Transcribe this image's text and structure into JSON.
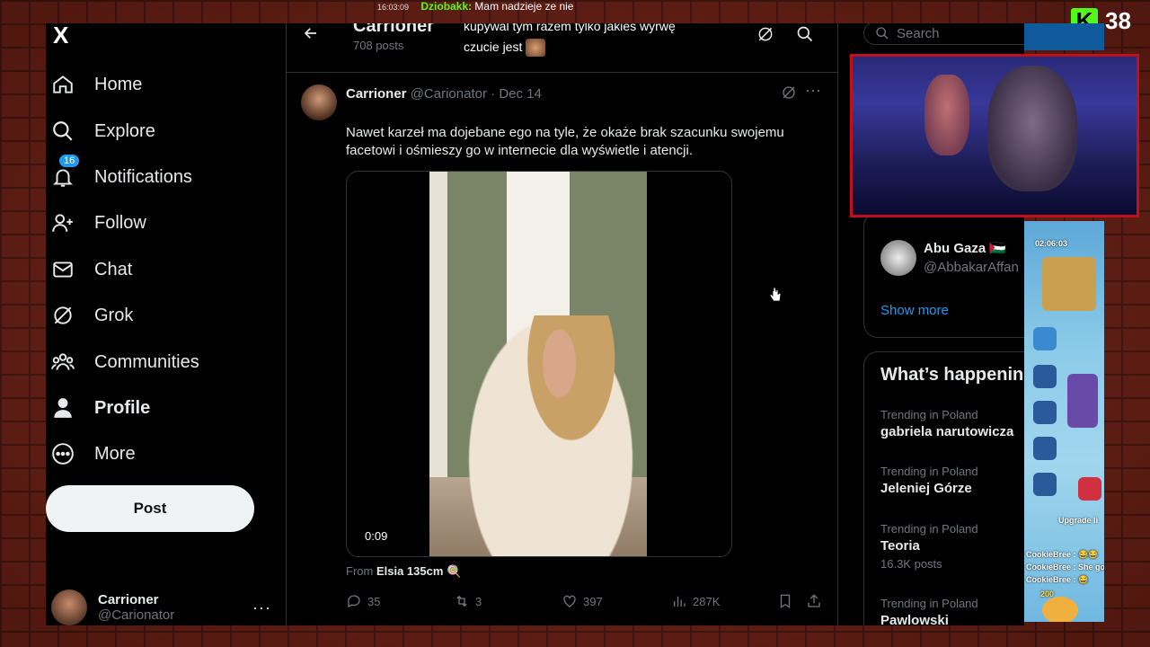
{
  "overlay": {
    "timestamp": "16:03:09",
    "chat_nick": "Dziobakk:",
    "chat_msg": "Mam nadzieje ze nie",
    "chat_line2": "kupywal tym razem tylko jakies wyrwę",
    "chat_line3": "czucie jest",
    "kick_letter": "K",
    "viewer_count": "38"
  },
  "nav": {
    "logo": "X",
    "items": [
      {
        "label": "Home",
        "icon": "home-icon"
      },
      {
        "label": "Explore",
        "icon": "search-icon"
      },
      {
        "label": "Notifications",
        "icon": "bell-icon",
        "badge": "16"
      },
      {
        "label": "Follow",
        "icon": "follow-icon"
      },
      {
        "label": "Chat",
        "icon": "mail-icon"
      },
      {
        "label": "Grok",
        "icon": "grok-icon"
      },
      {
        "label": "Communities",
        "icon": "communities-icon"
      },
      {
        "label": "Profile",
        "icon": "profile-icon"
      },
      {
        "label": "More",
        "icon": "more-circle-icon"
      }
    ],
    "post_label": "Post",
    "account": {
      "name": "Carrioner",
      "handle": "@Carionator",
      "more": "···"
    }
  },
  "header": {
    "title": "Carrioner",
    "subtitle": "708 posts"
  },
  "tweet": {
    "name": "Carrioner",
    "handle": "@Carionator",
    "sep": "·",
    "date": "Dec 14",
    "text": "Nawet karzeł ma dojebane ego na tyle, że okaże brak szacunku swojemu facetowi i ośmieszy go w internecie dla wyświetle i atencji.",
    "video_time": "0:09",
    "from_label": "From",
    "from_name": "Elsia 135cm 🍭",
    "replies": "35",
    "reposts": "3",
    "likes": "397",
    "views": "287K"
  },
  "right": {
    "search_placeholder": "Search",
    "who_to_follow": {
      "name": "Abu Gaza 🇵🇸",
      "handle": "@AbbakarAffan"
    },
    "show_more": "Show more",
    "trends_title": "What’s happening",
    "trends": [
      {
        "meta": "Trending in Poland",
        "name": "gabriela narutowicza",
        "count": ""
      },
      {
        "meta": "Trending in Poland",
        "name": "Jeleniej Górze",
        "count": ""
      },
      {
        "meta": "Trending in Poland",
        "name": "Teoria",
        "count": "16.3K posts"
      },
      {
        "meta": "Trending in Poland",
        "name": "Pawlowski",
        "count": ""
      }
    ]
  },
  "game": {
    "timer": "02:06:03",
    "upgrade": "Upgrade li",
    "chat1": "CookieBree : 😂😂",
    "chat2": "CookieBree : She go",
    "chat3": "CookieBree : 😂",
    "level": "200"
  },
  "colors": {
    "accent": "#1d9bf0",
    "kick": "#53fc18",
    "webcam_border": "#c0101c"
  }
}
